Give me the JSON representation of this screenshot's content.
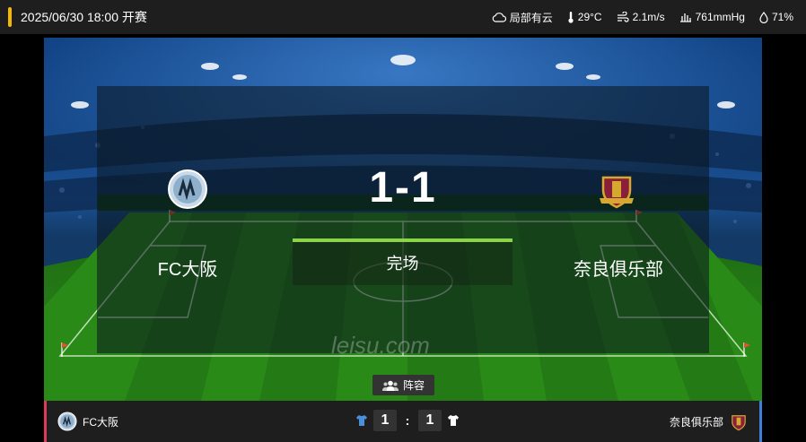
{
  "header": {
    "datetime": "2025/06/30 18:00 开赛",
    "weather": {
      "condition": "局部有云",
      "temperature": "29°C",
      "wind": "2.1m/s",
      "pressure": "761mmHg",
      "humidity": "71%"
    }
  },
  "match": {
    "home_team": "FC大阪",
    "away_team": "奈良俱乐部",
    "score_display": "1-1",
    "home_score": "1",
    "away_score": "1",
    "status": "完场",
    "watermark": "leisu.com"
  },
  "lineup_button": "阵容",
  "colors": {
    "accent_yellow": "#f5b800",
    "status_green": "#8bd44a",
    "home_color": "#e0395a",
    "away_color": "#3f7fd8",
    "home_kit": "#4a8fd8",
    "away_kit": "#ffffff"
  },
  "icons": [
    "cloud-icon",
    "thermometer-icon",
    "wind-icon",
    "pressure-icon",
    "humidity-icon",
    "people-icon",
    "home-jersey-icon",
    "away-jersey-icon"
  ]
}
